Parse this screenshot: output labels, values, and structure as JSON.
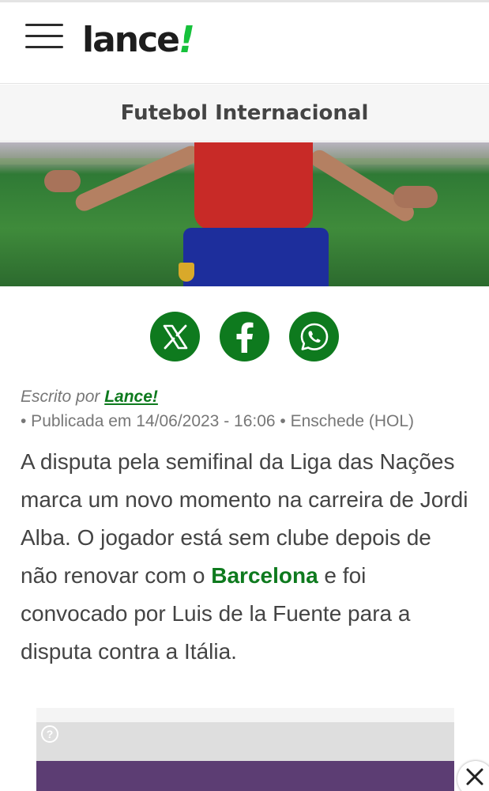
{
  "header": {
    "menu_icon": "hamburger-menu-icon",
    "logo_text": "lance",
    "logo_mark": "!",
    "brand_color": "#16c13b"
  },
  "section": {
    "title": "Futebol Internacional"
  },
  "share": {
    "buttons": [
      {
        "icon": "x-twitter-icon"
      },
      {
        "icon": "facebook-icon"
      },
      {
        "icon": "whatsapp-icon"
      }
    ],
    "color": "#0e7a1e"
  },
  "byline": {
    "label": "Escrito por",
    "author": "Lance!"
  },
  "meta": {
    "published": "• Publicada em 14/06/2023 - 16:06 • Enschede (HOL)"
  },
  "article": {
    "text_before": "A disputa pela semifinal da Liga das Nações marca um novo momento na carreira de Jordi Alba. O jogador está sem clube depois de não renovar com o ",
    "link_text": "Barcelona",
    "text_after": " e foi convocado por Luis de la Fuente para a disputa contra a Itália.",
    "link_color": "#0e7a1e"
  },
  "ad": {
    "info_glyph": "?",
    "close_icon": "close-icon"
  }
}
